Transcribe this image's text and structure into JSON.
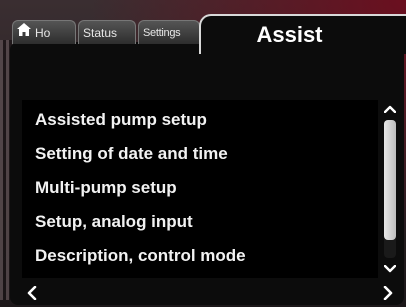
{
  "tabs": {
    "home_label": "Ho",
    "status_label": "Status",
    "settings_label": "Settings",
    "active_label": "Assist"
  },
  "menu": {
    "items": [
      "Assisted pump setup",
      "Setting of date and time",
      "Multi-pump setup",
      "Setup, analog input",
      "Description, control mode"
    ]
  },
  "icons": {
    "home": "home-icon",
    "scroll_up": "chevron-up-icon",
    "scroll_down": "chevron-down-icon",
    "back": "chevron-left-icon",
    "forward": "chevron-right-icon"
  },
  "colors": {
    "background": "#0c0c0c",
    "text": "#f2f2f2",
    "accent": "#6b0f1f"
  }
}
